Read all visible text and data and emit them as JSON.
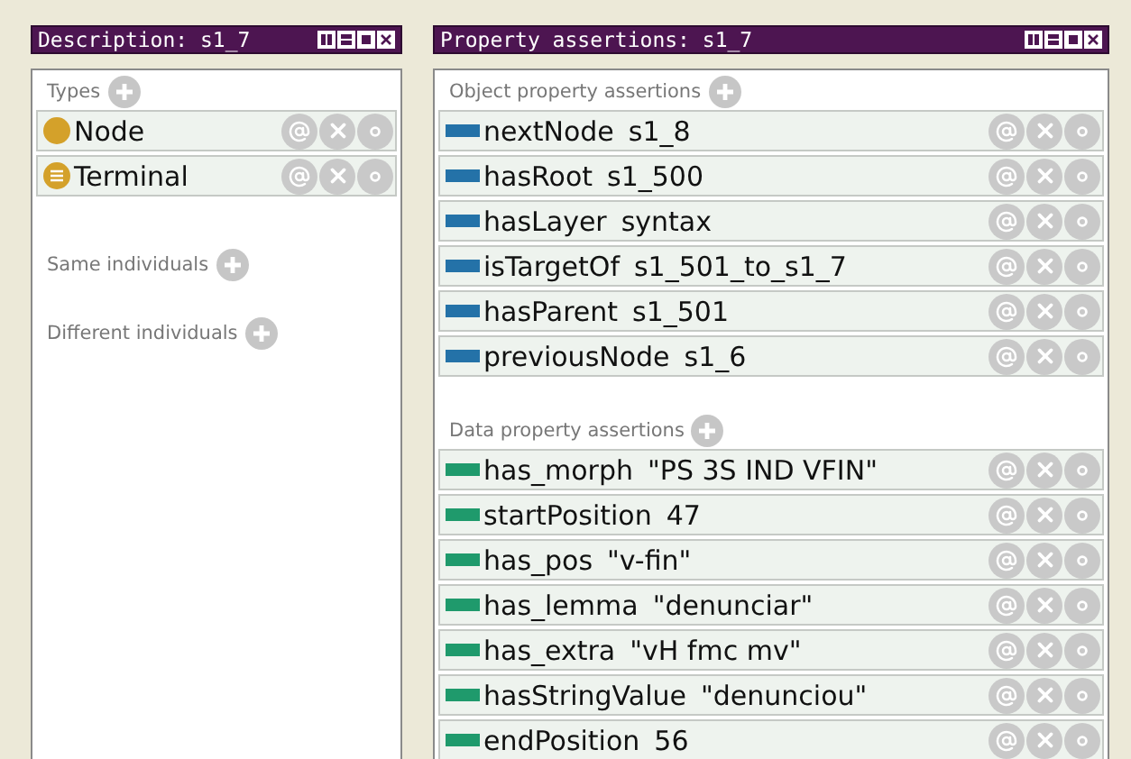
{
  "description_panel": {
    "title": "Description: s1_7",
    "sections": [
      {
        "heading": "Types",
        "items": [
          {
            "label": "Node",
            "kind": "class"
          },
          {
            "label": "Terminal",
            "kind": "defined"
          }
        ]
      },
      {
        "heading": "Same individuals"
      },
      {
        "heading": "Different individuals"
      }
    ]
  },
  "assertions_panel": {
    "title": "Property assertions: s1_7",
    "sections": [
      {
        "heading": "Object property assertions",
        "kind": "object",
        "items": [
          {
            "property": "nextNode",
            "value": "s1_8"
          },
          {
            "property": "hasRoot",
            "value": "s1_500"
          },
          {
            "property": "hasLayer",
            "value": "syntax"
          },
          {
            "property": "isTargetOf",
            "value": "s1_501_to_s1_7"
          },
          {
            "property": "hasParent",
            "value": "s1_501"
          },
          {
            "property": "previousNode",
            "value": "s1_6"
          }
        ]
      },
      {
        "heading": "Data property assertions",
        "kind": "data",
        "items": [
          {
            "property": "has_morph",
            "value": "\"PS 3S IND VFIN\""
          },
          {
            "property": "startPosition",
            "value": "47"
          },
          {
            "property": "has_pos",
            "value": "\"v-fin\""
          },
          {
            "property": "has_lemma",
            "value": "\"denunciar\""
          },
          {
            "property": "has_extra",
            "value": "\"vH fmc mv\""
          },
          {
            "property": "hasStringValue",
            "value": "\"denunciou\""
          },
          {
            "property": "endPosition",
            "value": "56"
          }
        ]
      }
    ]
  }
}
